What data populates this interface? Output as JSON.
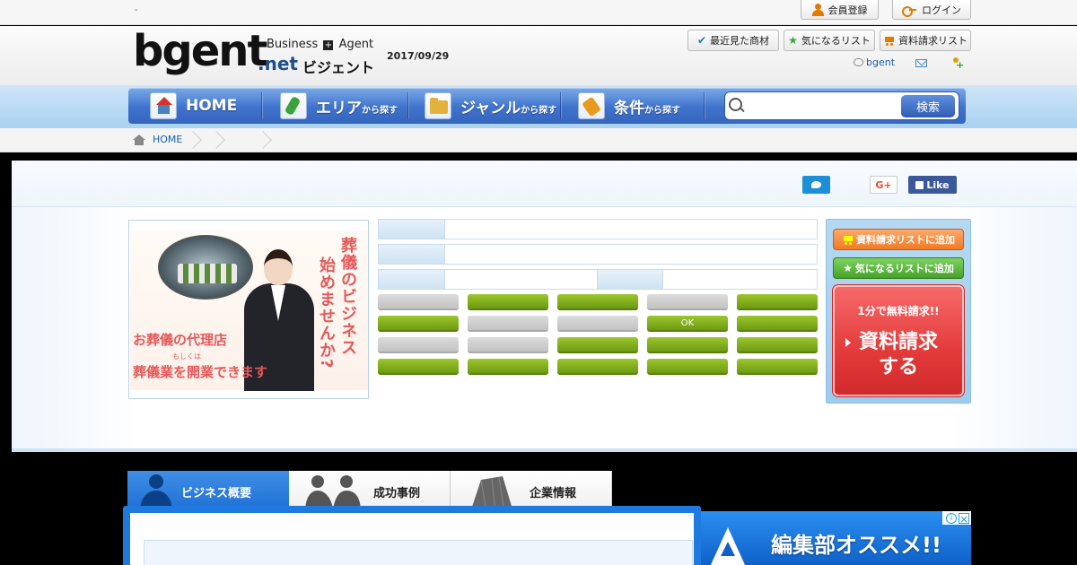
{
  "topbar": {
    "dash": "-",
    "register_label": "会員登録",
    "login_label": "ログイン"
  },
  "header": {
    "logo_main": "bgent",
    "logo_net": ".net",
    "logo_business": "Business",
    "logo_plus": "+",
    "logo_agent": "Agent",
    "logo_kana": "ビジェント",
    "date": "2017/09/29",
    "recent_label": "最近見た商材",
    "favorites_label": "気になるリスト",
    "request_list_label": "資料請求リスト",
    "bgent_link": "bgent"
  },
  "nav": {
    "items": [
      {
        "label": "HOME",
        "suffix": ""
      },
      {
        "label": "エリア",
        "suffix": "から探す"
      },
      {
        "label": "ジャンル",
        "suffix": "から探す"
      },
      {
        "label": "条件",
        "suffix": "から探す"
      }
    ],
    "search_placeholder": "",
    "search_button": "検索"
  },
  "breadcrumb": {
    "home_label": "HOME"
  },
  "social": {
    "gplus_label": "G+",
    "fb_label": "Like"
  },
  "ad": {
    "vertical_1": "葬儀のビジネス",
    "vertical_2": "始めませんか?",
    "line1": "お葬儀の代理店",
    "line2": "もしくは",
    "line3": "葬儀業を開業できます"
  },
  "tags": {
    "ok_label": "OK"
  },
  "sidebar": {
    "add_request_label": "資料請求リストに追加",
    "add_favorite_label": "気になるリストに追加",
    "cta_small": "1分で無料請求!!",
    "cta_big_1": "資料請求",
    "cta_big_2": "する"
  },
  "tabs": [
    {
      "label": "ビジネス概要"
    },
    {
      "label": "成功事例"
    },
    {
      "label": "企業情報"
    }
  ],
  "editor_banner": {
    "text": "編集部オススメ!!"
  },
  "colors": {
    "nav_blue": "#3f72cc",
    "tag_green": "#7cab1c",
    "cta_red": "#e33a3a",
    "fb_blue": "#3b5998",
    "twitter_blue": "#1d8fd8"
  }
}
